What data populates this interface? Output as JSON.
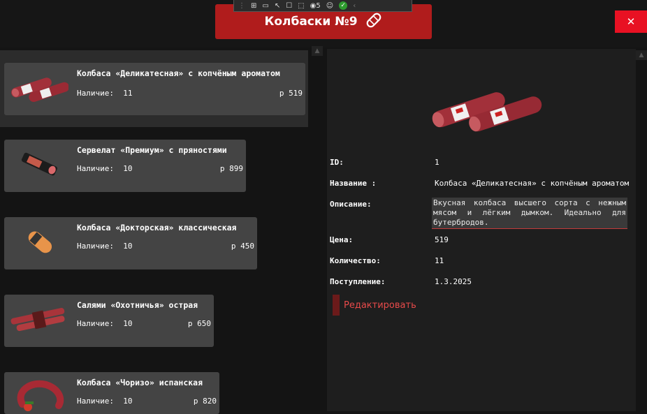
{
  "header": {
    "title": "Колбаски №9"
  },
  "devtools": {
    "badge_count": "5"
  },
  "products": [
    {
      "name": "Колбаса «Деликатесная» с копчёным ароматом",
      "avail_label": "Наличие:",
      "qty": "11",
      "price": "р 519"
    },
    {
      "name": "Сервелат «Премиум» с пряностями",
      "avail_label": "Наличие:",
      "qty": "10",
      "price": "р 899"
    },
    {
      "name": "Колбаса «Докторская» классическая",
      "avail_label": "Наличие:",
      "qty": "10",
      "price": "р 450"
    },
    {
      "name": "Салями «Охотничья» острая",
      "avail_label": "Наличие:",
      "qty": "10",
      "price": "р 650"
    },
    {
      "name": "Колбаса «Чоризо» испанская",
      "avail_label": "Наличие:",
      "qty": "10",
      "price": "р 820"
    }
  ],
  "detail": {
    "id_label": "ID:",
    "id": "1",
    "name_label": "Название :",
    "name": "Колбаса «Деликатесная» с копчёным ароматом",
    "desc_label": "Описание:",
    "desc": "Вкусная колбаса высшего сорта с нежным мясом и лёгким дымком. Идеально для бутербродов.",
    "price_label": "Цена:",
    "price": "519",
    "qty_label": "Количество:",
    "qty": "11",
    "date_label": "Поступление:",
    "date": "1.3.2025",
    "edit_label": "Редактировать"
  }
}
